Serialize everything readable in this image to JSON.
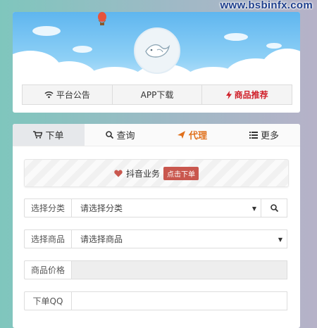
{
  "watermark": "www.bsbinfx.com",
  "top_tabs": [
    {
      "label": "平台公告",
      "icon": "wifi-icon"
    },
    {
      "label": "APP下载",
      "icon": ""
    },
    {
      "label": "商品推荐",
      "icon": "bolt-icon"
    }
  ],
  "main_tabs": [
    {
      "label": "下单",
      "icon": "cart-icon"
    },
    {
      "label": "查询",
      "icon": "search-icon"
    },
    {
      "label": "代理",
      "icon": "plane-icon"
    },
    {
      "label": "更多",
      "icon": "list-icon"
    }
  ],
  "notice": {
    "text": "抖音业务",
    "badge": "点击下单"
  },
  "form": {
    "category_label": "选择分类",
    "category_value": "请选择分类",
    "product_label": "选择商品",
    "product_value": "请选择商品",
    "price_label": "商品价格",
    "price_value": "",
    "qq_label": "下单QQ",
    "qq_value": ""
  },
  "colors": {
    "accent_red": "#d0202a",
    "accent_orange": "#e0701b",
    "badge": "#c9574e"
  }
}
